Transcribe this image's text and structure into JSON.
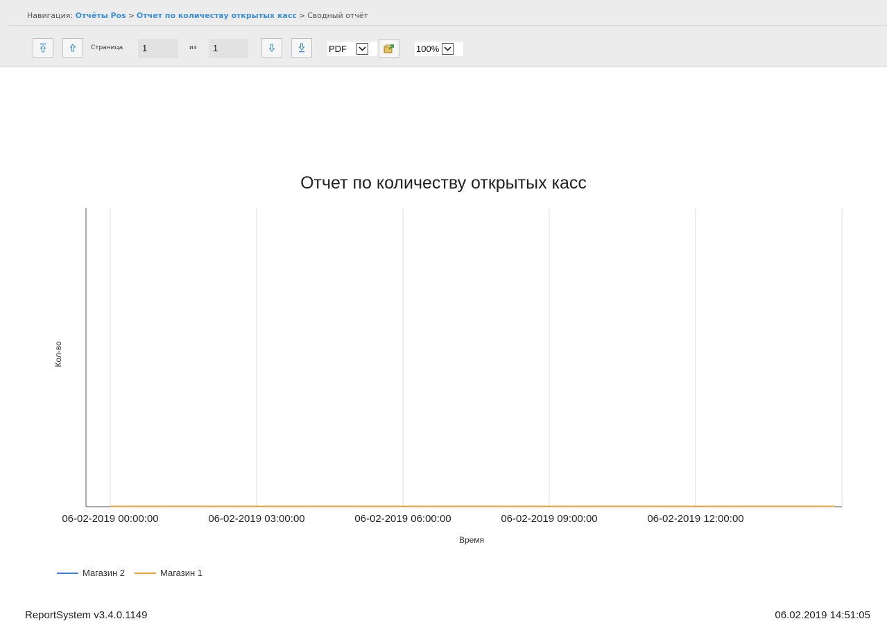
{
  "breadcrumb": {
    "prefix": "Навигация:",
    "items": [
      "Отчёты Pos",
      "Отчет по количеству открытых касс",
      "Сводный отчёт"
    ],
    "separator": ">"
  },
  "toolbar": {
    "first_page_icon": "arrow-up-to-line-icon",
    "prev_page_icon": "arrow-up-icon",
    "page_label": "Страница",
    "page_value": "1",
    "of_label": "из",
    "total_pages": "1",
    "next_page_icon": "arrow-down-icon",
    "last_page_icon": "arrow-down-to-line-icon",
    "export_format": "PDF",
    "export_icon": "export-icon",
    "zoom": "100%"
  },
  "colors": {
    "link": "#3b8fd6",
    "toolbar_bg": "#ececec",
    "series_1": "#3b7fe0",
    "series_2": "#f0a030"
  },
  "chart_data": {
    "type": "line",
    "title": "Отчет по количеству открытых касс",
    "xlabel": "Время",
    "ylabel": "Кол-во",
    "x_ticks": [
      "06-02-2019 00:00:00",
      "06-02-2019 03:00:00",
      "06-02-2019 06:00:00",
      "06-02-2019 09:00:00",
      "06-02-2019 12:00:00"
    ],
    "x_range": [
      "06-02-2019 00:00:00",
      "06-02-2019 14:51:05"
    ],
    "grid": "vertical",
    "legend": "bottom-left",
    "series": [
      {
        "name": "Магазин 2",
        "color": "#3b7fe0",
        "x": [
          "06-02-2019 00:00:00",
          "06-02-2019 14:51:05"
        ],
        "values": [
          0,
          0
        ]
      },
      {
        "name": "Магазин 1",
        "color": "#f0a030",
        "x": [
          "06-02-2019 00:00:00",
          "06-02-2019 14:51:05"
        ],
        "values": [
          0,
          0
        ]
      }
    ]
  },
  "footer": {
    "version": "ReportSystem v3.4.0.1149",
    "timestamp": "06.02.2019 14:51:05"
  }
}
